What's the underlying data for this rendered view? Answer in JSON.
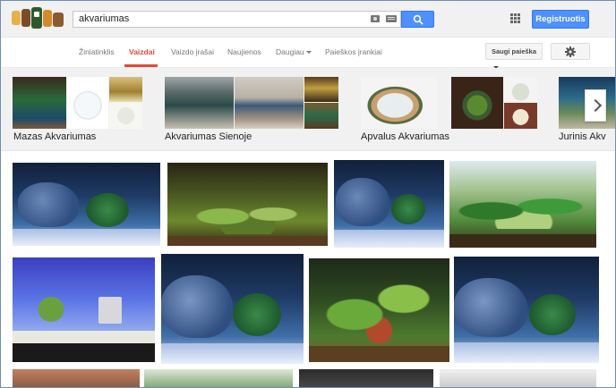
{
  "search": {
    "query": "akvariumas"
  },
  "header": {
    "register_label": "Registruotis"
  },
  "nav": {
    "tabs": [
      "Žiniatinklis",
      "Vaizdai",
      "Vaizdo įrašai",
      "Naujienos",
      "Daugiau",
      "Paieškos įrankiai"
    ],
    "active_tab": "Vaizdai",
    "safe_search_label": "Saugi paieška"
  },
  "related": [
    {
      "label": "Mazas Akvariumas"
    },
    {
      "label": "Akvariumas Sienoje"
    },
    {
      "label": "Apvalus Akvariumas"
    },
    {
      "label": "Jurinis Akv"
    }
  ],
  "colors": {
    "accent_red": "#dd4b39",
    "button_blue": "#4d90fe"
  },
  "icons": [
    "camera-icon",
    "keyboard-icon",
    "search-icon",
    "apps-grid-icon",
    "gear-icon",
    "chevron-right-icon"
  ]
}
